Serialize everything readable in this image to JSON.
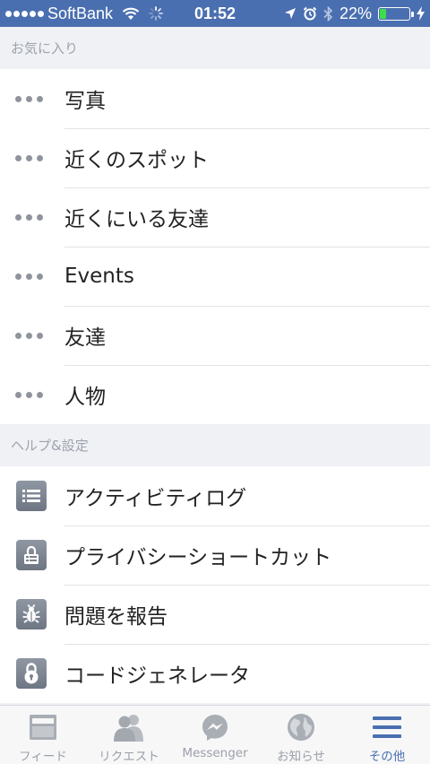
{
  "status_bar": {
    "carrier": "SoftBank",
    "time": "01:52",
    "battery_percent": "22%",
    "battery_level": 0.22,
    "signal_bars": 5
  },
  "favorites": {
    "header": "お気に入り",
    "items": [
      {
        "label": "写真",
        "icon": "more-dots-icon"
      },
      {
        "label": "近くのスポット",
        "icon": "more-dots-icon"
      },
      {
        "label": "近くにいる友達",
        "icon": "more-dots-icon"
      },
      {
        "label": "Events",
        "icon": "more-dots-icon"
      },
      {
        "label": "友達",
        "icon": "more-dots-icon"
      },
      {
        "label": "人物",
        "icon": "more-dots-icon"
      }
    ]
  },
  "help_settings": {
    "header": "ヘルプ&設定",
    "items": [
      {
        "label": "アクティビティログ",
        "icon": "activity-log-icon"
      },
      {
        "label": "プライバシーショートカット",
        "icon": "privacy-lock-icon"
      },
      {
        "label": "問題を報告",
        "icon": "bug-icon"
      },
      {
        "label": "コードジェネレータ",
        "icon": "code-generator-lock-icon"
      }
    ]
  },
  "tab_bar": {
    "tabs": [
      {
        "label": "フィード",
        "icon": "news-feed-icon",
        "active": false
      },
      {
        "label": "リクエスト",
        "icon": "friend-requests-icon",
        "active": false
      },
      {
        "label": "Messenger",
        "icon": "messenger-icon",
        "active": false
      },
      {
        "label": "お知らせ",
        "icon": "notifications-globe-icon",
        "active": false
      },
      {
        "label": "その他",
        "icon": "more-menu-icon",
        "active": true
      }
    ]
  },
  "colors": {
    "status_bar_bg": "#4a6fb0",
    "active_tab": "#4a6fb0",
    "inactive_tab": "#9ba0a8",
    "section_header_text": "#9da3ad",
    "battery_fill": "#3ddc4b"
  }
}
